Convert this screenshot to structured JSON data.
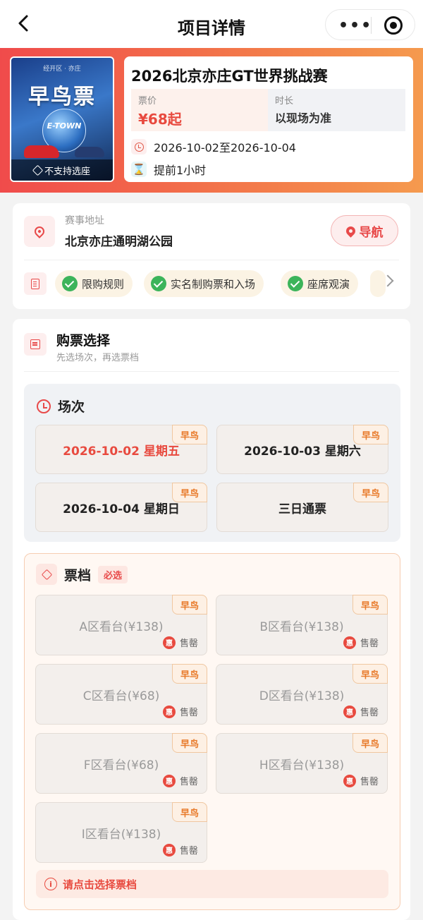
{
  "nav": {
    "title": "项目详情",
    "more_label": "•••"
  },
  "event": {
    "poster": {
      "brand_text": "经开区 · 亦庄",
      "headline": "早鸟票",
      "globe_text": "E-TOWN",
      "strip_text": "不支持选座"
    },
    "title": "2026北京亦庄GT世界挑战赛",
    "price_label": "票价",
    "price_value": "¥68起",
    "duration_label": "时长",
    "duration_value": "以现场为准",
    "date_range": "2026-10-02至2026-10-04",
    "advance": "提前1小时"
  },
  "venue": {
    "label": "赛事地址",
    "address": "北京亦庄通明湖公园",
    "nav_button": "导航",
    "chips": [
      "限购规则",
      "实名制购票和入场",
      "座席观演"
    ]
  },
  "purchase": {
    "title": "购票选择",
    "subtitle": "先选场次，再选票档",
    "session_title": "场次",
    "early_bird": "早鸟",
    "sessions": [
      {
        "label": "2026-10-02 星期五",
        "selected": true
      },
      {
        "label": "2026-10-03 星期六",
        "selected": false
      },
      {
        "label": "2026-10-04 星期日",
        "selected": false
      },
      {
        "label": "三日通票",
        "selected": false
      }
    ],
    "tier_title": "票档",
    "tier_required": "必选",
    "sold_out": "售罄",
    "discount_badge": "惠",
    "tiers": [
      "A区看台(¥138)",
      "B区看台(¥138)",
      "C区看台(¥68)",
      "D区看台(¥138)",
      "F区看台(¥68)",
      "H区看台(¥138)",
      "I区看台(¥138)"
    ],
    "hint": "请点击选择票档"
  },
  "colors": {
    "accent": "#e84a3f",
    "early_bird": "#e87a2a",
    "check": "#3cb45a"
  }
}
